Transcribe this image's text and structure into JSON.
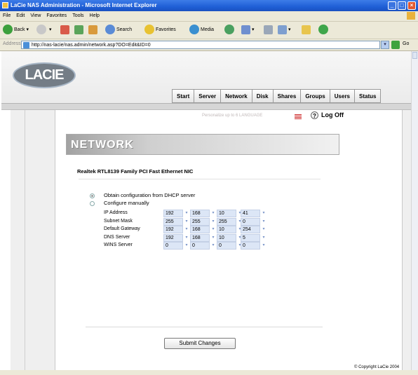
{
  "window": {
    "title": "LaCie NAS Administration - Microsoft Internet Explorer",
    "min": "_",
    "max": "□",
    "close": "×"
  },
  "menu": [
    "File",
    "Edit",
    "View",
    "Favorites",
    "Tools",
    "Help"
  ],
  "toolbar": {
    "back": "Back",
    "search": "Search",
    "favorites": "Favorites",
    "media": "Media"
  },
  "address": {
    "label": "Address",
    "url": "http://nas-lacie/nas.admin/network.asp?DO=Edit&ID=0",
    "go": "Go"
  },
  "brand": {
    "logo": "LACIE"
  },
  "tabs": [
    "Start",
    "Server",
    "Network",
    "Disk",
    "Shares",
    "Groups",
    "Users",
    "Status"
  ],
  "help": {
    "faint_text": "Personalize up to 6 LANGUAGE",
    "logoff": "Log Off"
  },
  "section": {
    "title": "NETWORK",
    "nic": "Realtek RTL8139 Family PCI Fast Ethernet NIC"
  },
  "options": [
    {
      "label": "Obtain configuration from DHCP server",
      "selected": true
    },
    {
      "label": "Configure manually",
      "selected": false
    }
  ],
  "fields": [
    {
      "label": "IP Address",
      "octets": [
        "192",
        "168",
        "10",
        "41"
      ]
    },
    {
      "label": "Subnet Mask",
      "octets": [
        "255",
        "255",
        "255",
        "0"
      ]
    },
    {
      "label": "Default Gateway",
      "octets": [
        "192",
        "168",
        "10",
        "254"
      ]
    },
    {
      "label": "DNS Server",
      "octets": [
        "192",
        "168",
        "10",
        "5"
      ]
    },
    {
      "label": "WINS Server",
      "octets": [
        "0",
        "0",
        "0",
        "0"
      ]
    }
  ],
  "submit_label": "Submit Changes",
  "footer": {
    "copyright": "© Copyright LaCie 2004"
  },
  "colors": {
    "titlebar": "#245edb",
    "octet_bg": "#dce6f6"
  }
}
